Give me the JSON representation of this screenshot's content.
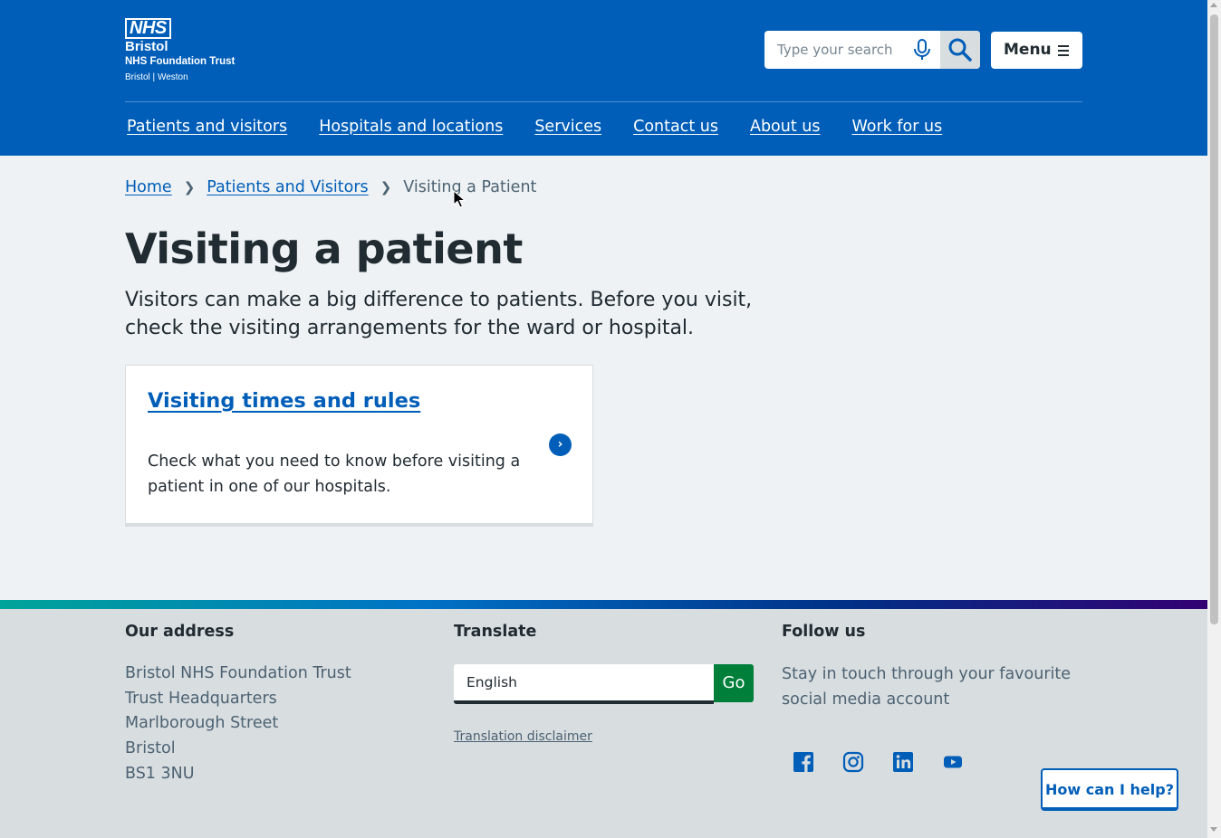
{
  "header": {
    "logo": {
      "nhs": "NHS",
      "name": "Bristol",
      "trust": "NHS Foundation Trust",
      "sites": "Bristol | Weston"
    },
    "search": {
      "placeholder": "Type your search"
    },
    "menu_label": "Menu",
    "nav": [
      "Patients and visitors",
      "Hospitals and locations",
      "Services",
      "Contact us",
      "About us",
      "Work for us"
    ],
    "colors": {
      "brand_blue": "#005eb8"
    }
  },
  "breadcrumb": {
    "items": [
      "Home",
      "Patients and Visitors"
    ],
    "current": "Visiting a Patient"
  },
  "page": {
    "title": "Visiting a patient",
    "lede": "Visitors can make a big difference to patients. Before you visit, check the visiting arrangements for the ward or hospital."
  },
  "card": {
    "title": "Visiting times and rules",
    "description": "Check what you need to know before visiting a patient in one of our hospitals.",
    "arrow_icon": "chevron-right-icon"
  },
  "footer": {
    "address": {
      "heading": "Our address",
      "lines": [
        "Bristol NHS Foundation Trust",
        "Trust Headquarters",
        "Marlborough Street",
        "Bristol",
        "BS1 3NU"
      ]
    },
    "translate": {
      "heading": "Translate",
      "selected_language": "English",
      "go_label": "Go",
      "disclaimer": "Translation disclaimer"
    },
    "follow": {
      "heading": "Follow us",
      "text": "Stay in touch through your favourite social media account",
      "icons": [
        "facebook-icon",
        "instagram-icon",
        "linkedin-icon",
        "youtube-icon"
      ]
    },
    "colors": {
      "go_green": "#007f3b"
    }
  },
  "help_button": "How can I help?"
}
